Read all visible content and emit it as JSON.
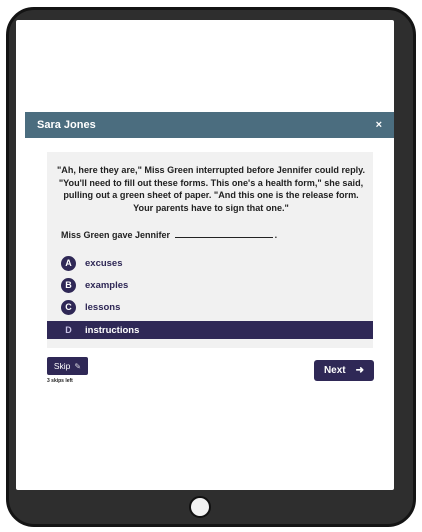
{
  "modal": {
    "student_name": "Sara Jones",
    "close_symbol": "×"
  },
  "question": {
    "passage_lines": [
      "\"Ah, here they are,\" Miss Green interrupted before Jennifer could reply.",
      "\"You'll need to fill out these forms. This one's a health form,\" she said,",
      "pulling out a green sheet of paper. \"And this one is the release form.",
      "Your parents have to sign that one.\""
    ],
    "prompt_before": "Miss Green gave Jennifer",
    "prompt_after": ".",
    "options": [
      {
        "letter": "A",
        "text": "excuses"
      },
      {
        "letter": "B",
        "text": "examples"
      },
      {
        "letter": "C",
        "text": "lessons"
      },
      {
        "letter": "D",
        "text": "instructions",
        "selected": true
      }
    ]
  },
  "skip": {
    "label": "Skip",
    "icon": "pencil-icon",
    "remaining_text": "3 skips left"
  },
  "next": {
    "label": "Next",
    "icon": "arrow-right-icon"
  },
  "colors": {
    "header": "#4b6d7f",
    "accent": "#2f2856",
    "card": "#f1f1f1",
    "tablet_frame": "#2e2e2e"
  }
}
